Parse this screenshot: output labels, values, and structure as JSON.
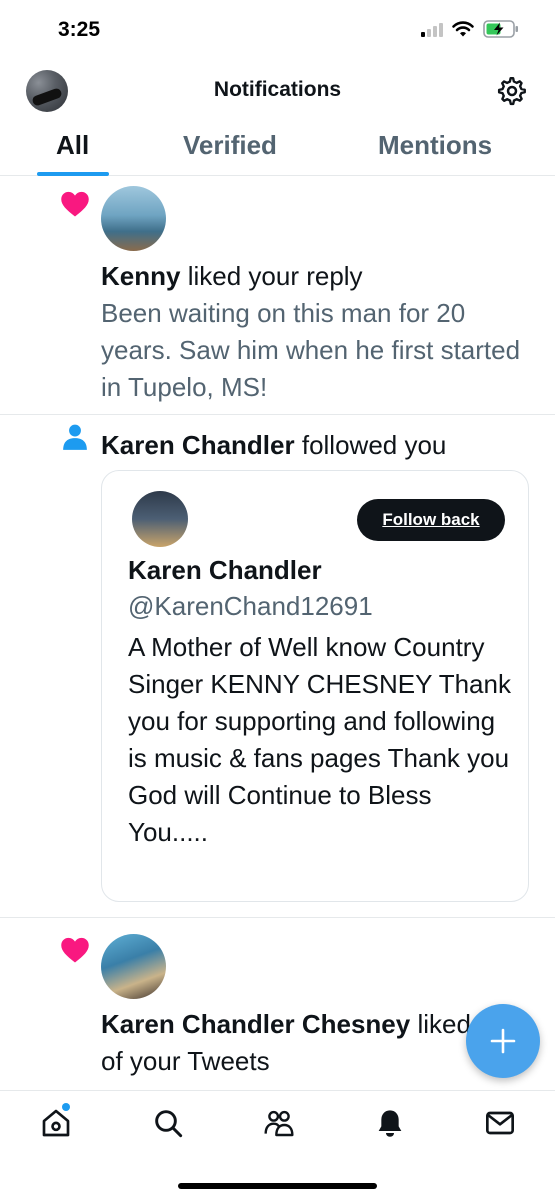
{
  "status_bar": {
    "time": "3:25"
  },
  "header": {
    "title": "Notifications"
  },
  "tabs": [
    {
      "label": "All",
      "active": true
    },
    {
      "label": "Verified",
      "active": false
    },
    {
      "label": "Mentions",
      "active": false
    }
  ],
  "notifications": [
    {
      "type": "like",
      "icon": "heart-icon",
      "user": "Kenny",
      "action": "liked your reply",
      "text": "Been waiting on this man for 20 years. Saw him when he first started in Tupelo, MS!"
    },
    {
      "type": "follow",
      "icon": "person-icon",
      "user": "Karen Chandler",
      "action": "followed you",
      "card": {
        "follow_label": "Follow back",
        "name": "Karen Chandler",
        "handle": "@KarenChand12691",
        "bio": "A Mother of Well know Country Singer KENNY CHESNEY Thank you for supporting and following is music & fans pages Thank you God will Continue to Bless You....."
      }
    },
    {
      "type": "like",
      "icon": "heart-icon",
      "user": "Karen Chandler Chesney",
      "action": "liked 2 of your Tweets"
    }
  ],
  "colors": {
    "accent": "#1d9bf0",
    "heart": "#f91880",
    "secondary_text": "#536471",
    "fab": "#4aa3ec"
  },
  "bottom_nav": [
    "home-icon",
    "search-icon",
    "communities-icon",
    "notifications-icon",
    "messages-icon"
  ]
}
